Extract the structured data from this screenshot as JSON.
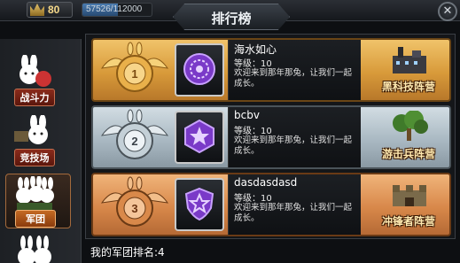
{
  "topbar": {
    "level": "80",
    "exp_text": "57526/112000",
    "exp_fraction": 0.514
  },
  "title": "排行榜",
  "close_label": "✕",
  "sidebar": {
    "items": [
      {
        "label": "战斗力",
        "active": false
      },
      {
        "label": "竞技场",
        "active": false
      },
      {
        "label": "军团",
        "active": true
      },
      {
        "label": "",
        "active": false
      }
    ]
  },
  "ranking": [
    {
      "rank": 1,
      "name": "海水如心",
      "level": "等级：10",
      "desc": "欢迎来到那年那兔，让我们一起成长。",
      "camp": "黑科技阵营",
      "tier": "gold"
    },
    {
      "rank": 2,
      "name": "bcbv",
      "level": "等级：10",
      "desc": "欢迎来到那年那兔，让我们一起成长。",
      "camp": "游击兵阵营",
      "tier": "silver"
    },
    {
      "rank": 3,
      "name": "dasdasdasd",
      "level": "等级：10",
      "desc": "欢迎来到那年那兔，让我们一起成长。",
      "camp": "冲锋者阵营",
      "tier": "bronze"
    }
  ],
  "my_rank": "我的军团排名:4",
  "colors": {
    "gold": "#e8b45a",
    "silver": "#b9c6cf",
    "bronze": "#e29a5e",
    "emblem": "#8a4ad8"
  }
}
